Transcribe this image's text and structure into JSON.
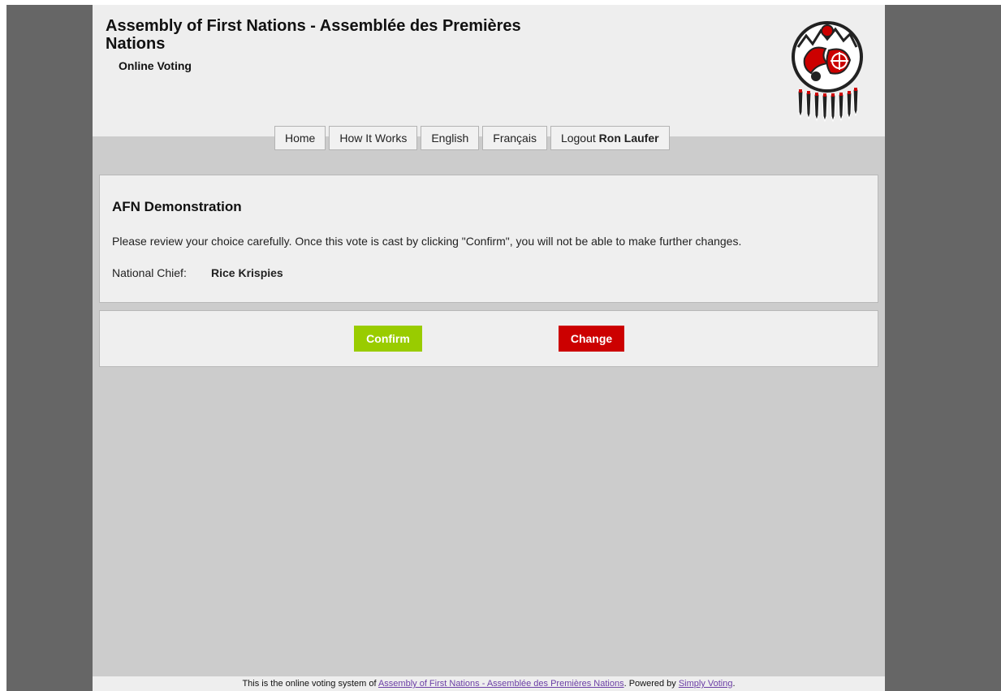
{
  "header": {
    "title": "Assembly of First Nations - Assemblée des Premières Nations",
    "subtitle": "Online Voting",
    "logo": "afn-emblem-icon"
  },
  "nav": {
    "home": "Home",
    "how_it_works": "How It Works",
    "english": "English",
    "francais": "Français",
    "logout": "Logout",
    "user_name": "Ron Laufer"
  },
  "ballot": {
    "election_title": "AFN Demonstration",
    "instruction": "Please review your choice carefully. Once this vote is cast by clicking \"Confirm\", you will not be able to make further changes.",
    "position_label": "National Chief:",
    "choice": "Rice Krispies"
  },
  "actions": {
    "confirm": "Confirm",
    "change": "Change"
  },
  "footer": {
    "prefix": "This is the online voting system of",
    "org_link": "Assembly of First Nations - Assemblée des Premières Nations",
    "middle": ". Powered by",
    "powered_link": "Simply Voting",
    "suffix": "."
  },
  "colors": {
    "frame": "#666666",
    "content_bg": "#cccccc",
    "header_bg": "#eeeeee",
    "confirm": "#99cc00",
    "change": "#cc0000",
    "link": "#6b3ea5"
  }
}
